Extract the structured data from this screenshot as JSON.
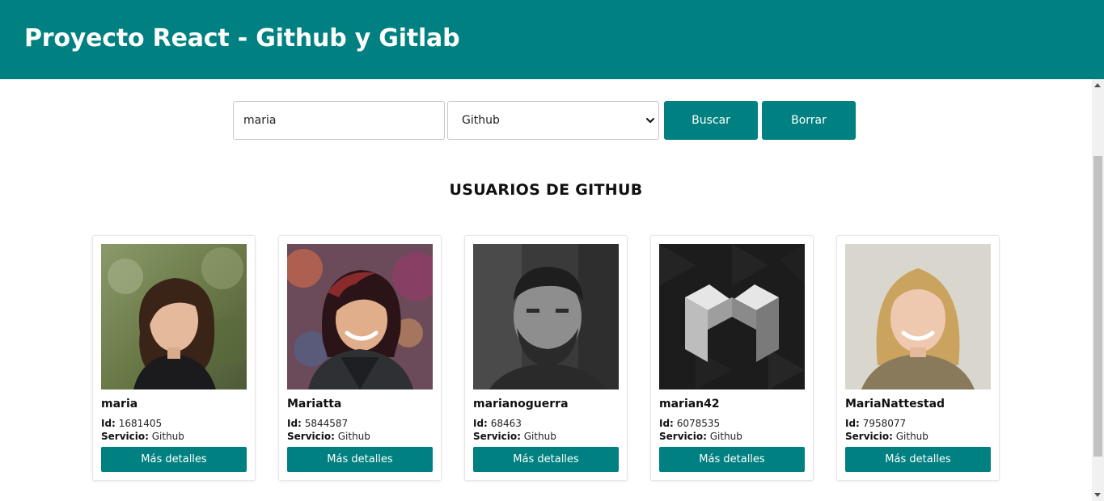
{
  "header": {
    "title": "Proyecto React - Github y Gitlab"
  },
  "search": {
    "value": "maria",
    "service_selected": "Github"
  },
  "buttons": {
    "search_label": "Buscar",
    "clear_label": "Borrar"
  },
  "results": {
    "section_title": "USUARIOS DE GITHUB",
    "id_label": "Id:",
    "service_label": "Servicio:",
    "details_label": "Más detalles",
    "users": [
      {
        "login": "maria",
        "id": "1681405",
        "service": "Github",
        "avatar": "photo-woman-outdoors"
      },
      {
        "login": "Mariatta",
        "id": "5844587",
        "service": "Github",
        "avatar": "photo-woman-hoodie"
      },
      {
        "login": "marianoguerra",
        "id": "68463",
        "service": "Github",
        "avatar": "photo-man-bw"
      },
      {
        "login": "marian42",
        "id": "6078535",
        "service": "Github",
        "avatar": "logo-m-isometric"
      },
      {
        "login": "MariaNattestad",
        "id": "7958077",
        "service": "Github",
        "avatar": "photo-woman-blonde"
      }
    ]
  },
  "colors": {
    "primary": "#008080",
    "background": "#ffffff",
    "text": "#111111"
  }
}
